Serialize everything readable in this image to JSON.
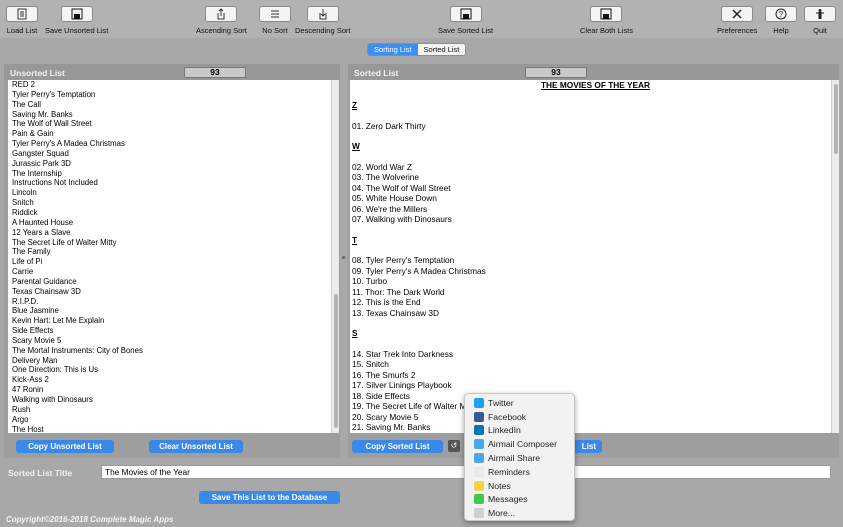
{
  "toolbar": {
    "load_list": "Load List",
    "save_unsorted": "Save Unsorted List",
    "ascending_sort": "Ascending Sort",
    "no_sort": "No Sort",
    "descending_sort": "Descending Sort",
    "save_sorted": "Save Sorted List",
    "clear_both": "Clear Both Lists",
    "preferences": "Preferences",
    "help": "Help",
    "quit": "Quit"
  },
  "tabs": {
    "sorting": "Sorting List",
    "sorted": "Sorted List"
  },
  "unsorted": {
    "title": "Unsorted List",
    "count": "93",
    "items": [
      "RED 2",
      "Tyler Perry's Temptation",
      "The Call",
      "Saving Mr. Banks",
      "The Wolf of Wall Street",
      "Pain & Gain",
      "Tyler Perry's A Madea Christmas",
      "Gangster Squad",
      "Jurassic Park 3D",
      "The Internship",
      "Instructions Not Included",
      "Lincoln",
      "Snitch",
      "Riddick",
      "A Haunted House",
      "12 Years a Slave",
      "The Secret Life of Walter Mitty",
      "The Family",
      "Life of Pi",
      "Carrie",
      "Parental Guidance",
      "Texas Chainsaw 3D",
      "R.I.P.D.",
      "Blue Jasmine",
      "Kevin Hart: Let Me Explain",
      "Side Effects",
      "Scary Movie 5",
      "The Mortal Instruments: City of Bones",
      "Delivery Man",
      "One Direction: This is Us",
      "Kick-Ass 2",
      "47 Ronin",
      "Walking with Dinosaurs",
      "Rush",
      "Argo",
      "The Host"
    ],
    "copy_button": "Copy Unsorted List",
    "clear_button": "Clear Unsorted List"
  },
  "sorted": {
    "title": "Sorted List",
    "count": "93",
    "heading": "THE MOVIES OF THE YEAR",
    "groups": [
      {
        "letter": "Z",
        "items": [
          "01. Zero Dark Thirty"
        ]
      },
      {
        "letter": "W",
        "items": [
          "02. World War Z",
          "03. The Wolverine",
          "04. The Wolf of Wall Street",
          "05. White House Down",
          "06. We're the Millers",
          "07. Walking with Dinosaurs"
        ]
      },
      {
        "letter": "T",
        "items": [
          "08. Tyler Perry's Temptation",
          "09. Tyler Perry's A Madea Christmas",
          "10. Turbo",
          "11. Thor: The Dark World",
          "12. This is the End",
          "13. Texas Chainsaw 3D"
        ]
      },
      {
        "letter": "S",
        "items": [
          "14. Star Trek Into Darkness",
          "15. Snitch",
          "16. The Smurfs 2",
          "17. Silver Linings Playbook",
          "18. Side Effects",
          "19. The Secret Life of Walter Mitty",
          "20. Scary Movie 5",
          "21. Saving Mr. Banks"
        ]
      }
    ],
    "copy_button": "Copy Sorted List",
    "hidden_button_tail": "List"
  },
  "title_field": {
    "label": "Sorted List Title",
    "value": "The Movies of the Year"
  },
  "save_db_button": "Save This List to the Database",
  "copyright": "Copyright©2016-2018 Complete Magic Apps",
  "share_menu": [
    {
      "label": "Twitter",
      "icon": "twitter-icon",
      "color": "#1da1f2"
    },
    {
      "label": "Facebook",
      "icon": "facebook-icon",
      "color": "#3b5998"
    },
    {
      "label": "LinkedIn",
      "icon": "linkedin-icon",
      "color": "#0077b5"
    },
    {
      "label": "Airmail Composer",
      "icon": "airmail-icon",
      "color": "#4aa8e8"
    },
    {
      "label": "Airmail Share",
      "icon": "airmail-icon",
      "color": "#4aa8e8"
    },
    {
      "label": "Reminders",
      "icon": "reminders-icon",
      "color": "#e8e8e8"
    },
    {
      "label": "Notes",
      "icon": "notes-icon",
      "color": "#f2d34a"
    },
    {
      "label": "Messages",
      "icon": "messages-icon",
      "color": "#3ec950"
    },
    {
      "label": "More...",
      "icon": "more-icon",
      "color": "#cfcfcf"
    }
  ]
}
